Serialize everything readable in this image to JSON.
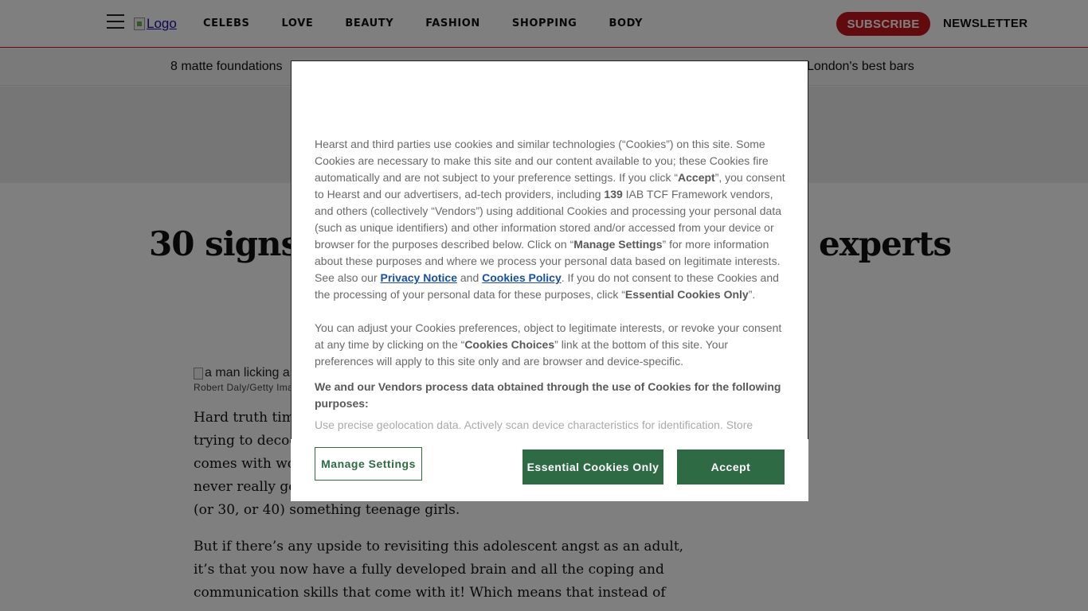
{
  "header": {
    "logo_alt": "Logo",
    "nav": [
      "CELEBS",
      "LOVE",
      "BEAUTY",
      "FASHION",
      "SHOPPING",
      "BODY"
    ],
    "subscribe_label": "SUBSCRIBE",
    "newsletter_label": "NEWSLETTER",
    "accent_color": "#c4161c"
  },
  "trending": {
    "left": "8 matte foundations",
    "right": "London's best bars"
  },
  "article": {
    "headline_left": "30 signs",
    "headline_right": "experts",
    "image_alt": "a man licking a",
    "image_credit": "Robert Daly/Getty Ima",
    "p1_lines": [
      "Hard truth tim",
      "trying to decod",
      "comes with wo",
      "never really go",
      "(or 30, or 40) something teenage girls."
    ],
    "p2_lines": [
      "But if there’s any upside to revisiting this adolescent angst as an adult,",
      "it’s that you now have a fully developed brain and all the coping and",
      "communication skills that come with it! Which means that instead of"
    ]
  },
  "cookie_dialog": {
    "p1": {
      "t1": "Hearst and third parties use cookies and similar technologies (“Cookies”) on this site. Some Cookies are necessary to make this site and our content available to you; these Cookies fire automatically and are not subject to your preference settings. If you click “",
      "accept": "Accept",
      "t2": "”, you consent to Hearst and our advertisers, ad-tech providers, including ",
      "count": "139",
      "t3": " IAB TCF Framework vendors, and others (collectively “Vendors”) using additional Cookies and processing your personal data (such as unique identifiers) and other information stored and/or accessed from your device or browser for the purposes described below. Click on “",
      "manage": "Manage Settings",
      "t4": "” for more information about these purposes and where we process your personal data based on legitimate interests. See also our ",
      "privacy_link": "Privacy Notice",
      "t5": " and ",
      "cookies_link": "Cookies Policy",
      "t6": ". If you do not consent to these Cookies and the processing of your personal data for these purposes, click “",
      "essential": "Essential Cookies Only",
      "t7": "”."
    },
    "p2": {
      "t1": "You can adjust your Cookies preferences, object to legitimate interests, or revoke your consent at any time by clicking on the “",
      "choices": "Cookies Choices",
      "t2": "” link at the bottom of this site. Your preferences will apply to this site only and are browser and device-specific."
    },
    "purposes_heading": "We and our Vendors process data obtained through the use of Cookies for the following purposes:",
    "faded_line": "Use precise geolocation data. Actively scan device characteristics for identification. Store",
    "buttons": {
      "manage": "Manage Settings",
      "essential": "Essential Cookies Only",
      "accept": "Accept"
    },
    "button_color": "#2e6b45",
    "link_color": "#1a4fa3"
  }
}
